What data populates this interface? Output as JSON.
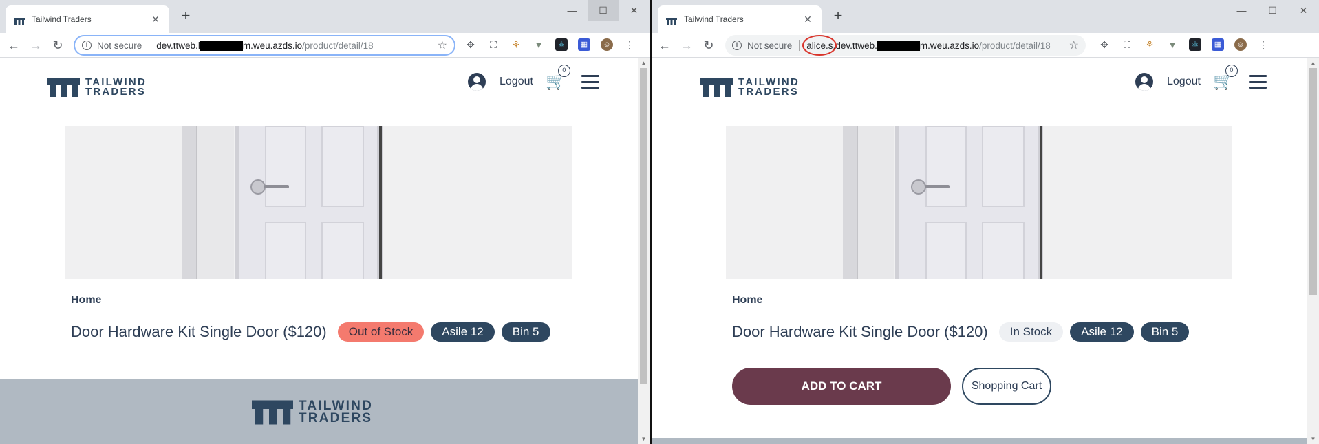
{
  "left": {
    "tab_title": "Tailwind Traders",
    "tab_close": "✕",
    "new_tab": "+",
    "win_min": "—",
    "win_max": "☐",
    "win_close": "✕",
    "back": "←",
    "forward": "→",
    "reload": "↻",
    "not_secure": "Not secure",
    "url_host_a": "dev.ttweb.l",
    "url_host_b": "m.weu.azds.io",
    "url_path": "/product/detail/18",
    "logo_line1": "TAILWIND",
    "logo_line2": "TRADERS",
    "logout": "Logout",
    "cart_count": "0",
    "breadcrumb": "Home",
    "product_name": "Door Hardware Kit Single Door ($120)",
    "stock": "Out of Stock",
    "aisle": "Asile 12",
    "bin": "Bin 5",
    "footer_logo_line1": "TAILWIND",
    "footer_logo_line2": "TRADERS"
  },
  "right": {
    "tab_title": "Tailwind Traders",
    "tab_close": "✕",
    "new_tab": "+",
    "win_min": "—",
    "win_max": "☐",
    "win_close": "✕",
    "back": "←",
    "forward": "→",
    "reload": "↻",
    "not_secure": "Not secure",
    "url_prefix": "alice.s.",
    "url_host_a": "dev.ttweb.",
    "url_host_b": "m.weu.azds.io",
    "url_path": "/product/detail/18",
    "logo_line1": "TAILWIND",
    "logo_line2": "TRADERS",
    "logout": "Logout",
    "cart_count": "0",
    "breadcrumb": "Home",
    "product_name": "Door Hardware Kit Single Door ($120)",
    "stock": "In Stock",
    "aisle": "Asile 12",
    "bin": "Bin 5",
    "add_to_cart": "ADD TO CART",
    "shopping_cart": "Shopping Cart"
  },
  "colors": {
    "brand_navy": "#2e4760",
    "out_of_stock": "#f47a6e",
    "add_to_cart": "#6a3a4c",
    "annotation_circle": "#d9342b"
  }
}
